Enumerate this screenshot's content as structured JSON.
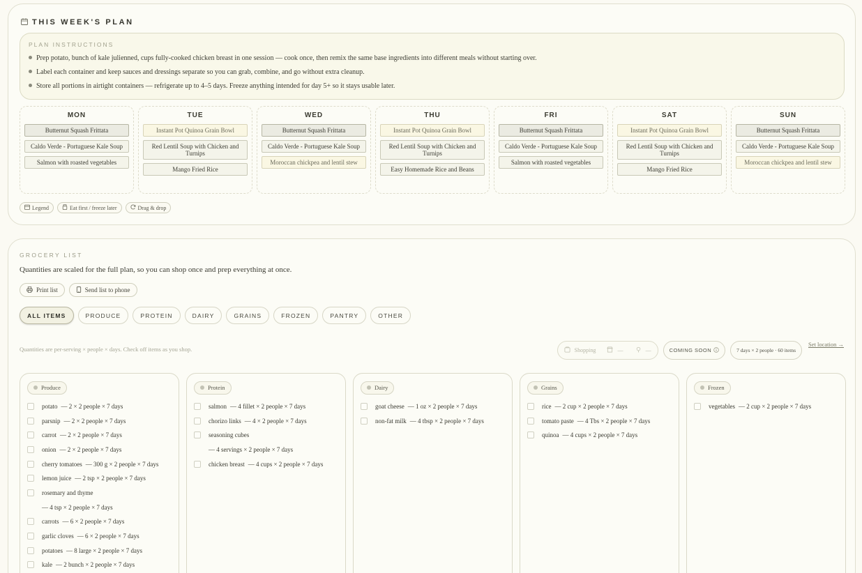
{
  "plan": {
    "title": "THIS WEEK'S PLAN",
    "instructions_title": "PLAN INSTRUCTIONS",
    "instructions": [
      "Prep potato, bunch of kale julienned, cups fully-cooked chicken breast in one session — cook once, then remix the same base ingredients into different meals without starting over.",
      "Label each container and keep sauces and dressings separate so you can grab, combine, and go without extra cleanup.",
      "Store all portions in airtight containers — refrigerate up to 4–5 days. Freeze anything intended for day 5+ so it stays usable later."
    ],
    "days": [
      {
        "name": "MON",
        "meals": [
          {
            "label": "Butternut Squash Frittata",
            "style": "dark"
          },
          {
            "label": "Caldo Verde - Portuguese Kale Soup",
            "style": "normal"
          },
          {
            "label": "Salmon with roasted vegetables",
            "style": "normal"
          }
        ]
      },
      {
        "name": "TUE",
        "meals": [
          {
            "label": "Instant Pot Quinoa Grain Bowl",
            "style": "light"
          },
          {
            "label": "Red Lentil Soup with Chicken and Turnips",
            "style": "normal"
          },
          {
            "label": "Mango Fried Rice",
            "style": "normal"
          }
        ]
      },
      {
        "name": "WED",
        "meals": [
          {
            "label": "Butternut Squash Frittata",
            "style": "dark"
          },
          {
            "label": "Caldo Verde - Portuguese Kale Soup",
            "style": "normal"
          },
          {
            "label": "Moroccan chickpea and lentil stew",
            "style": "light"
          }
        ]
      },
      {
        "name": "THU",
        "meals": [
          {
            "label": "Instant Pot Quinoa Grain Bowl",
            "style": "light"
          },
          {
            "label": "Red Lentil Soup with Chicken and Turnips",
            "style": "normal"
          },
          {
            "label": "Easy Homemade Rice and Beans",
            "style": "normal"
          }
        ]
      },
      {
        "name": "FRI",
        "meals": [
          {
            "label": "Butternut Squash Frittata",
            "style": "dark"
          },
          {
            "label": "Caldo Verde - Portuguese Kale Soup",
            "style": "normal"
          },
          {
            "label": "Salmon with roasted vegetables",
            "style": "normal"
          }
        ]
      },
      {
        "name": "SAT",
        "meals": [
          {
            "label": "Instant Pot Quinoa Grain Bowl",
            "style": "light"
          },
          {
            "label": "Red Lentil Soup with Chicken and Turnips",
            "style": "normal"
          },
          {
            "label": "Mango Fried Rice",
            "style": "normal"
          }
        ]
      },
      {
        "name": "SUN",
        "meals": [
          {
            "label": "Butternut Squash Frittata",
            "style": "dark"
          },
          {
            "label": "Caldo Verde - Portuguese Kale Soup",
            "style": "normal"
          },
          {
            "label": "Moroccan chickpea and lentil stew",
            "style": "light"
          }
        ]
      }
    ],
    "pills": [
      {
        "icon": "calendar-icon",
        "label": "Legend"
      },
      {
        "icon": "jar-icon",
        "label": "Eat first / freeze later"
      },
      {
        "icon": "refresh-icon",
        "label": "Drag & drop"
      }
    ]
  },
  "grocery": {
    "title": "GROCERY LIST",
    "subtitle": "Quantities are scaled for the full plan, so you can shop once and prep everything at once.",
    "actions": [
      {
        "icon": "printer-icon",
        "label": "Print list"
      },
      {
        "icon": "phone-icon",
        "label": "Send list to phone"
      }
    ],
    "tabs": [
      {
        "label": "ALL ITEMS",
        "active": true
      },
      {
        "label": "PRODUCE",
        "active": false
      },
      {
        "label": "PROTEIN",
        "active": false
      },
      {
        "label": "DAIRY",
        "active": false
      },
      {
        "label": "GRAINS",
        "active": false
      },
      {
        "label": "FROZEN",
        "active": false
      },
      {
        "label": "PANTRY",
        "active": false
      },
      {
        "label": "OTHER",
        "active": false
      }
    ],
    "note": "Quantities are per-serving × people × days. Check off items as you shop.",
    "shopping_label": "Shopping",
    "store_value": "—",
    "location_value": "—",
    "coming_soon": "COMING SOON",
    "meta": "7 days × 2 people · 60 items",
    "set_location": "Set location →",
    "categories": [
      {
        "name": "Produce",
        "items": [
          {
            "name": "potato",
            "qty": "— 2 × 2 people × 7 days",
            "check": true
          },
          {
            "name": "parsnip",
            "qty": "— 2 × 2 people × 7 days",
            "check": true
          },
          {
            "name": "carrot",
            "qty": "— 2 × 2 people × 7 days",
            "check": true
          },
          {
            "name": "onion",
            "qty": "— 2 × 2 people × 7 days",
            "check": true
          },
          {
            "name": "cherry tomatoes",
            "qty": "— 300 g × 2 people × 7 days",
            "check": true
          },
          {
            "name": "lemon juice",
            "qty": "— 2 tsp × 2 people × 7 days",
            "check": true
          },
          {
            "name": "rosemary and thyme",
            "qty": "",
            "check": true
          },
          {
            "name": "",
            "qty": "— 4 tsp × 2 people × 7 days",
            "check": false
          },
          {
            "name": "carrots",
            "qty": "— 6 × 2 people × 7 days",
            "check": true
          },
          {
            "name": "garlic cloves",
            "qty": "— 6 × 2 people × 7 days",
            "check": true
          },
          {
            "name": "potatoes",
            "qty": "— 8 large × 2 people × 7 days",
            "check": true
          },
          {
            "name": "kale",
            "qty": "— 2 bunch × 2 people × 7 days",
            "check": true
          }
        ]
      },
      {
        "name": "Protein",
        "items": [
          {
            "name": "salmon",
            "qty": "— 4 fillet × 2 people × 7 days",
            "check": true
          },
          {
            "name": "chorizo links",
            "qty": "— 4 × 2 people × 7 days",
            "check": true
          },
          {
            "name": "seasoning cubes",
            "qty": "",
            "check": true
          },
          {
            "name": "",
            "qty": "— 4 servings × 2 people × 7 days",
            "check": false
          },
          {
            "name": "chicken breast",
            "qty": "— 4 cups × 2 people × 7 days",
            "check": true
          }
        ]
      },
      {
        "name": "Dairy",
        "items": [
          {
            "name": "goat cheese",
            "qty": "— 1 oz × 2 people × 7 days",
            "check": true
          },
          {
            "name": "non-fat milk",
            "qty": "— 4 tbsp × 2 people × 7 days",
            "check": true
          }
        ]
      },
      {
        "name": "Grains",
        "items": [
          {
            "name": "rice",
            "qty": "— 2 cup × 2 people × 7 days",
            "check": true
          },
          {
            "name": "tomato paste",
            "qty": "— 4 Tbs × 2 people × 7 days",
            "check": true
          },
          {
            "name": "quinoa",
            "qty": "— 4 cups × 2 people × 7 days",
            "check": true
          }
        ]
      },
      {
        "name": "Frozen",
        "items": [
          {
            "name": "vegetables",
            "qty": "— 2 cup × 2 people × 7 days",
            "check": true
          }
        ]
      }
    ]
  }
}
